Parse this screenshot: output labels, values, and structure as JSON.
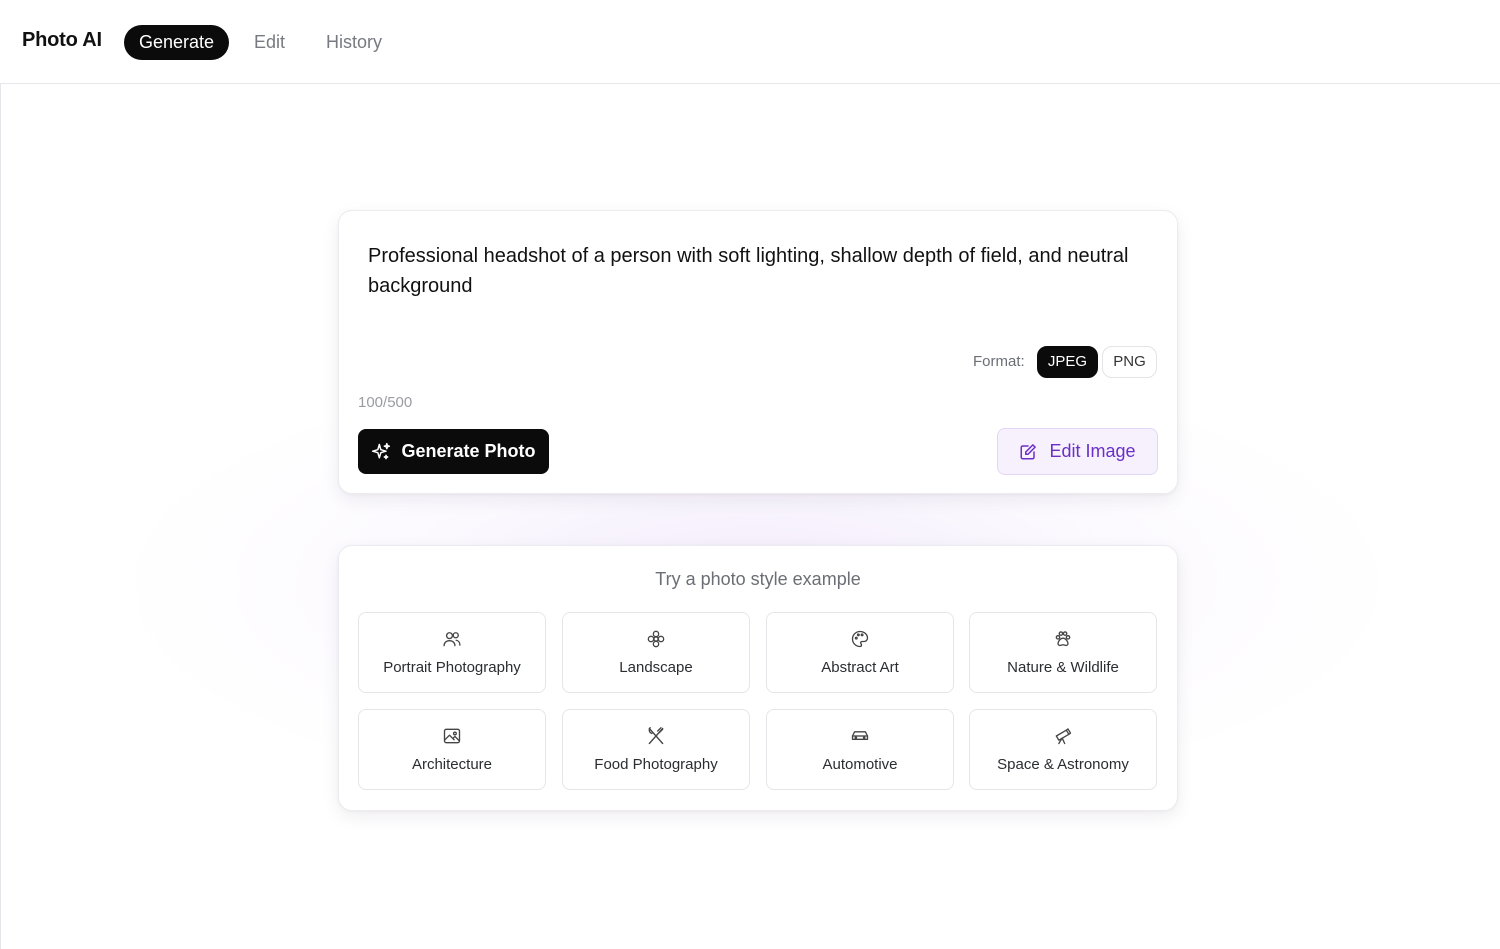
{
  "header": {
    "brand": "Photo AI",
    "tabs": [
      {
        "label": "Generate",
        "active": true
      },
      {
        "label": "Edit",
        "active": false
      },
      {
        "label": "History",
        "active": false
      }
    ]
  },
  "prompt": {
    "text": "Professional headshot of a person with soft lighting, shallow depth of field, and neutral background",
    "format_label": "Format:",
    "formats": [
      {
        "label": "JPEG",
        "selected": true
      },
      {
        "label": "PNG",
        "selected": false
      }
    ],
    "char_count": "100/500",
    "generate_label": "Generate Photo",
    "edit_label": "Edit Image"
  },
  "examples": {
    "title": "Try a photo style example",
    "items": [
      {
        "label": "Portrait Photography",
        "icon": "users-icon"
      },
      {
        "label": "Landscape",
        "icon": "flower-icon"
      },
      {
        "label": "Abstract Art",
        "icon": "palette-icon"
      },
      {
        "label": "Nature & Wildlife",
        "icon": "paw-icon"
      },
      {
        "label": "Architecture",
        "icon": "image-icon"
      },
      {
        "label": "Food Photography",
        "icon": "utensils-icon"
      },
      {
        "label": "Automotive",
        "icon": "car-icon"
      },
      {
        "label": "Space & Astronomy",
        "icon": "telescope-icon"
      }
    ]
  },
  "colors": {
    "accent_dark": "#0b0b0b",
    "edit_accent": "#6b2fc8",
    "edit_bg": "#f6f1fd"
  }
}
